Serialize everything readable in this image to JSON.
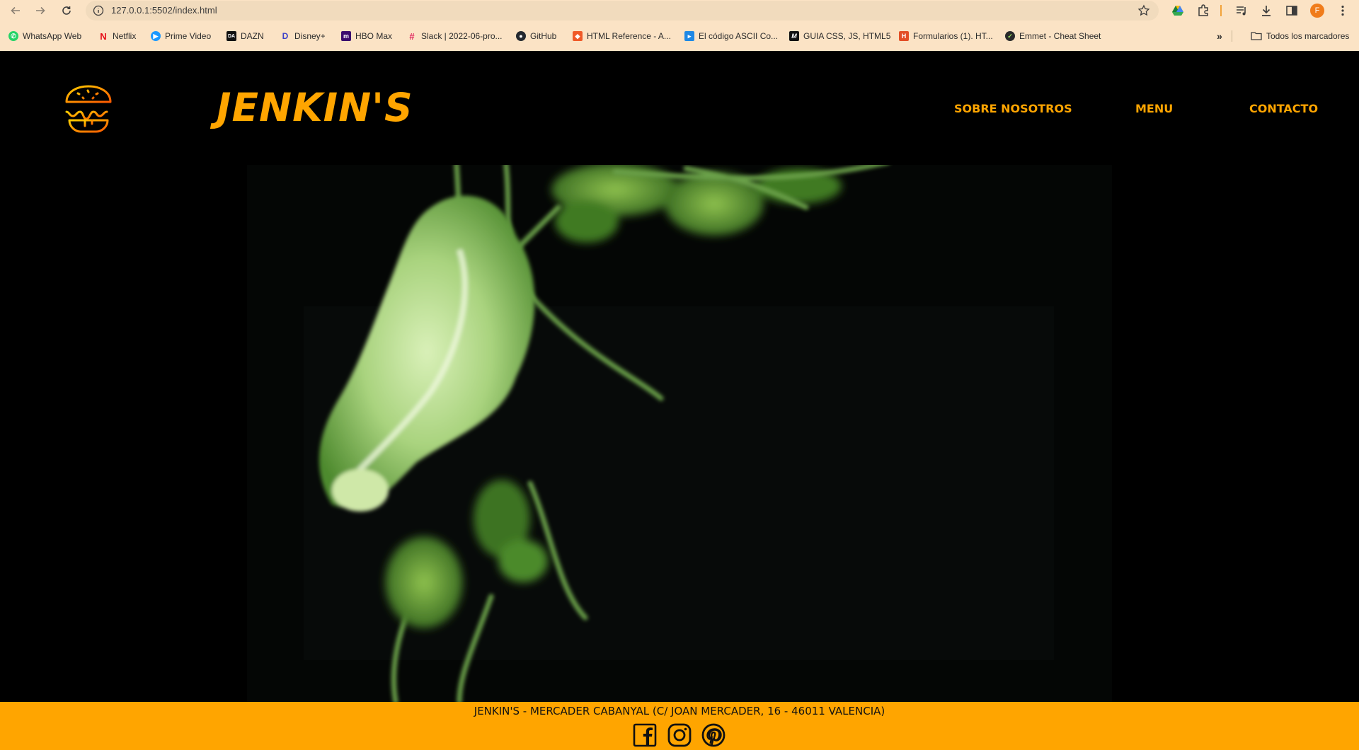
{
  "browser": {
    "url": "127.0.0.1:5502/index.html",
    "avatar_letter": "F",
    "bookmarks": [
      {
        "label": "WhatsApp Web",
        "icon": "whatsapp-icon",
        "color": "#25d366"
      },
      {
        "label": "Netflix",
        "icon": "netflix-icon",
        "color": "#e50914"
      },
      {
        "label": "Prime Video",
        "icon": "prime-video-icon",
        "color": "#1a98ff"
      },
      {
        "label": "DAZN",
        "icon": "dazn-icon",
        "color": "#111111"
      },
      {
        "label": "Disney+",
        "icon": "disney-icon",
        "color": "#3b40c9"
      },
      {
        "label": "HBO Max",
        "icon": "hbo-max-icon",
        "color": "#3a0b6e"
      },
      {
        "label": "Slack | 2022-06-pro...",
        "icon": "slack-icon",
        "color": "#e01e5a"
      },
      {
        "label": "GitHub",
        "icon": "github-icon",
        "color": "#24292f"
      },
      {
        "label": "HTML Reference - A...",
        "icon": "html-reference-icon",
        "color": "#f05a28"
      },
      {
        "label": "El código ASCII Co...",
        "icon": "ascii-icon",
        "color": "#1e88e5"
      },
      {
        "label": "GUIA CSS, JS, HTML5",
        "icon": "guia-icon",
        "color": "#111111"
      },
      {
        "label": "Formularios (1). HT...",
        "icon": "formularios-icon",
        "color": "#e34f26"
      },
      {
        "label": "Emmet - Cheat Sheet",
        "icon": "emmet-icon",
        "color": "#2a2a2a"
      }
    ],
    "all_bookmarks_label": "Todos los marcadores"
  },
  "site": {
    "brand": "JENKIN'S",
    "nav": [
      "SOBRE NOSOTROS",
      "MENU",
      "CONTACTO"
    ],
    "accent_color": "#ffa500",
    "footer_address": "JENKIN'S - MERCADER CABANYAL (C/ JOAN MERCADER, 16 - 46011 VALENCIA)",
    "social": [
      "facebook-icon",
      "instagram-icon",
      "pinterest-icon"
    ]
  }
}
